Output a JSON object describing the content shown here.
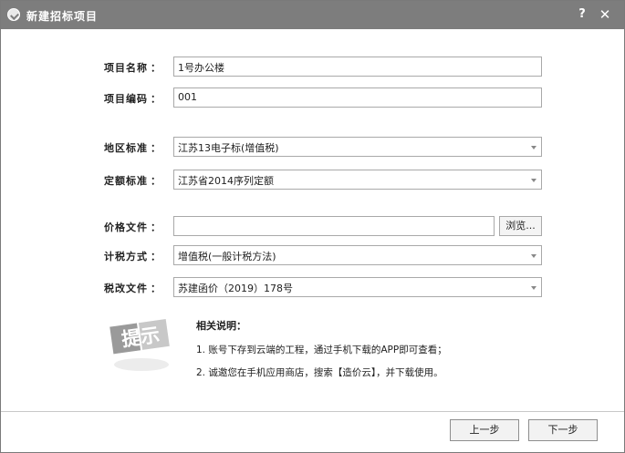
{
  "window": {
    "title": "新建招标项目",
    "help_label": "?",
    "close_label": "✕"
  },
  "fields": {
    "project_name": {
      "label": "项目名称",
      "colon": "：",
      "value": "1号办公楼"
    },
    "project_code": {
      "label": "项目编码",
      "colon": "：",
      "value": "001"
    },
    "region_standard": {
      "label": "地区标准",
      "colon": "：",
      "value": "江苏13电子标(增值税)"
    },
    "quota_standard": {
      "label": "定额标准",
      "colon": "：",
      "value": "江苏省2014序列定额"
    },
    "price_file": {
      "label": "价格文件",
      "colon": "：",
      "value": "",
      "browse_label": "浏览..."
    },
    "tax_method": {
      "label": "计税方式",
      "colon": "：",
      "value": "增值税(一般计税方法)"
    },
    "tax_reform_file": {
      "label": "税改文件",
      "colon": "：",
      "value": "苏建函价（2019）178号"
    }
  },
  "hint": {
    "icon_text": "提示",
    "title": "相关说明：",
    "line1": "1. 账号下存到云端的工程，通过手机下载的APP即可查看；",
    "line2": "2. 诚邀您在手机应用商店，搜索【造价云】，并下载使用。"
  },
  "footer": {
    "prev_label": "上一步",
    "next_label": "下一步"
  }
}
